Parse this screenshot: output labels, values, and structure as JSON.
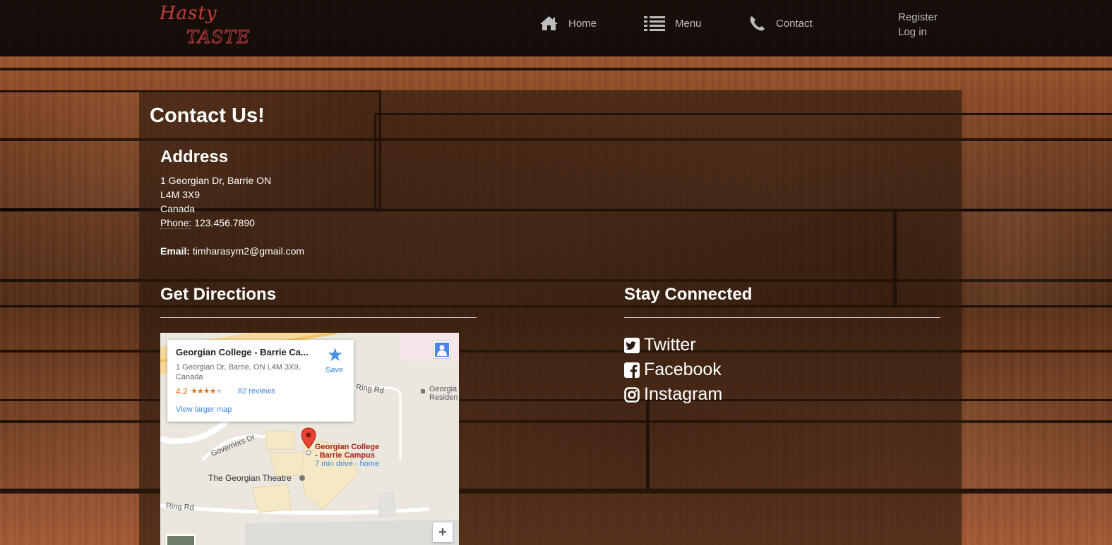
{
  "nav": {
    "logo_line1": "Hasty",
    "logo_line2": "TASTE",
    "home": "Home",
    "menu": "Menu",
    "contact": "Contact",
    "register": "Register",
    "login": "Log in"
  },
  "page": {
    "title": "Contact Us!"
  },
  "address": {
    "heading": "Address",
    "line1": "1 Georgian Dr, Barrie ON",
    "line2": "L4M 3X9",
    "line3": "Canada",
    "phone_label": "Phone:",
    "phone": "123.456.7890",
    "email_label": "Email:",
    "email": "timharasym2@gmail.com"
  },
  "directions": {
    "heading": "Get Directions"
  },
  "map": {
    "card_title": "Georgian College - Barrie Ca...",
    "card_address": "1 Georgian Dr, Barrie, ON L4M 3X9, Canada",
    "rating": "4.2",
    "stars_filled": "★★★★",
    "stars_empty": "★",
    "reviews": "82 reviews",
    "larger_map": "View larger map",
    "save": "Save",
    "place_name_line1": "Georgian College",
    "place_name_line2": "- Barrie Campus",
    "drive_time": "7 min drive - home",
    "theatre": "The Georgian Theatre",
    "ring_rd": "Ring Rd",
    "governors_dr": "Governors Dr",
    "georgian_res_line1": "Georgia",
    "georgian_res_line2": "Residen",
    "zoom_in": "+"
  },
  "connected": {
    "heading": "Stay Connected",
    "twitter": "Twitter",
    "facebook": "Facebook",
    "instagram": "Instagram"
  },
  "icons": {
    "home": "home-icon",
    "menu": "list-icon",
    "contact": "phone-icon",
    "twitter": "twitter-square-icon",
    "facebook": "facebook-square-icon",
    "instagram": "instagram-icon",
    "save": "star-icon",
    "pin": "map-pin-icon",
    "person": "pegman-icon"
  },
  "colors": {
    "logo_red": "#c83c3c",
    "nav_text": "#bdbdbd",
    "link_blue": "#3a84df",
    "rating_orange": "#e7711b"
  }
}
